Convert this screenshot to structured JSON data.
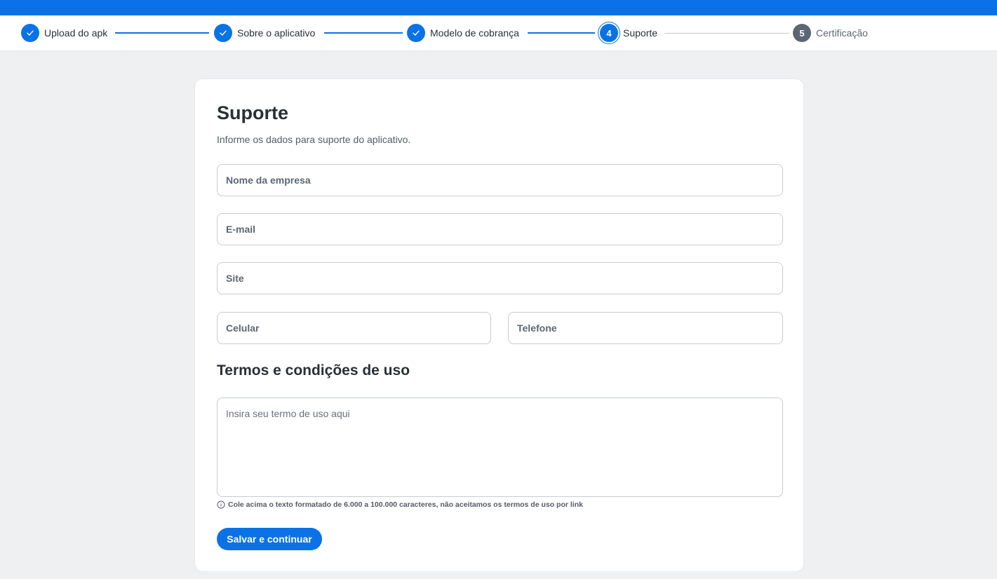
{
  "stepper": {
    "steps": [
      {
        "number": "1",
        "label": "Upload do apk",
        "status": "done"
      },
      {
        "number": "2",
        "label": "Sobre o aplicativo",
        "status": "done"
      },
      {
        "number": "3",
        "label": "Modelo de cobrança",
        "status": "done"
      },
      {
        "number": "4",
        "label": "Suporte",
        "status": "current"
      },
      {
        "number": "5",
        "label": "Certificação",
        "status": "pending"
      }
    ],
    "icons": {
      "done": "check-icon"
    }
  },
  "form": {
    "title": "Suporte",
    "subtitle": "Informe os dados para suporte do aplicativo.",
    "fields": {
      "company": {
        "placeholder": "Nome da empresa",
        "value": ""
      },
      "email": {
        "placeholder": "E-mail",
        "value": ""
      },
      "site": {
        "placeholder": "Site",
        "value": ""
      },
      "mobile": {
        "placeholder": "Celular",
        "value": ""
      },
      "phone": {
        "placeholder": "Telefone",
        "value": ""
      }
    },
    "terms": {
      "title": "Termos e condições de uso",
      "placeholder": "Insira seu termo de uso aqui",
      "hint": "Cole acima o texto formatado de 6.000 a 100.000 caracteres, não aceitamos os termos de uso por link",
      "hint_icon": "info-icon"
    },
    "submit_label": "Salvar e continuar"
  },
  "colors": {
    "accent": "#0a72e6",
    "pending_step": "#5d6673",
    "background": "#eff0f2",
    "card": "#ffffff"
  }
}
